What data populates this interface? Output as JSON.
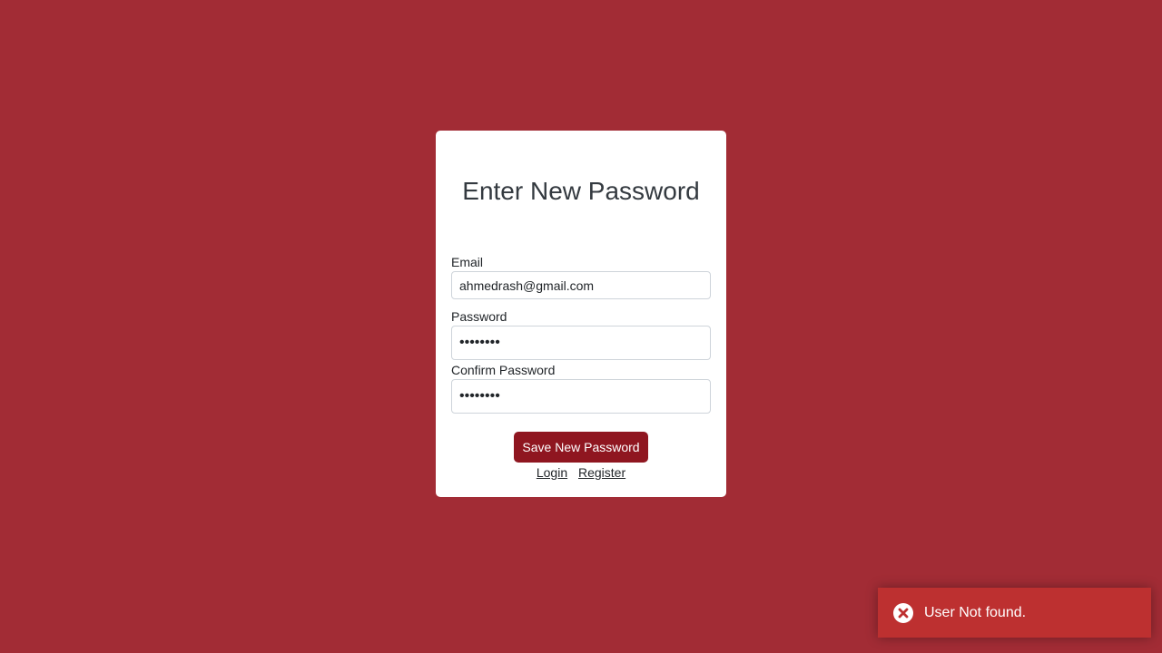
{
  "form": {
    "title": "Enter New Password",
    "email_label": "Email",
    "email_value": "ahmedrash@gmail.com",
    "password_label": "Password",
    "password_value": "••••••••",
    "confirm_label": "Confirm Password",
    "confirm_value": "••••••••",
    "save_label": "Save New Password",
    "login_link": "Login",
    "register_link": "Register"
  },
  "toast": {
    "icon": "error-circle-icon",
    "message": "User Not found."
  },
  "colors": {
    "background": "#a22c35",
    "button": "#8f1620",
    "toast": "#bd3030"
  }
}
